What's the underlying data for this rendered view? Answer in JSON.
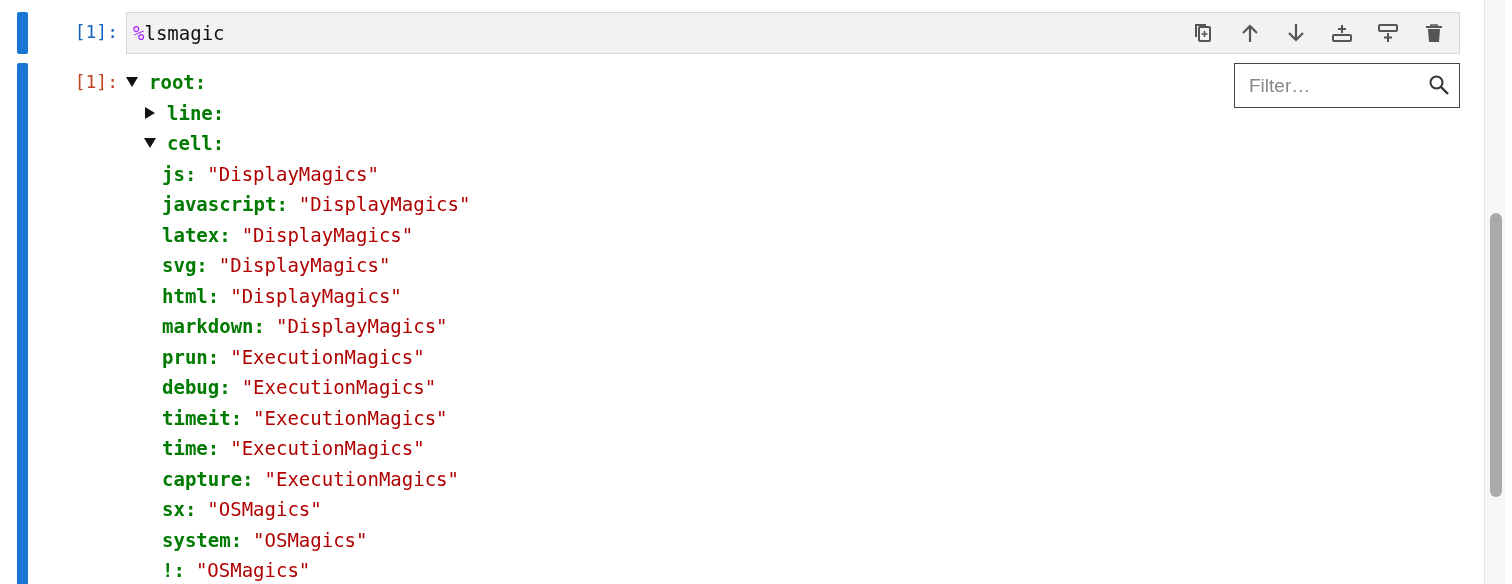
{
  "input_cell": {
    "prompt": "[1]:",
    "code": {
      "prefix": "%",
      "rest": "lsmagic"
    },
    "active": true,
    "toolbar": [
      {
        "kind": "duplicate"
      },
      {
        "kind": "move-up"
      },
      {
        "kind": "move-down"
      },
      {
        "kind": "insert-above"
      },
      {
        "kind": "insert-below"
      },
      {
        "kind": "delete"
      }
    ]
  },
  "output_cell": {
    "prompt": "[1]:",
    "active": true,
    "filter": {
      "placeholder": "Filter…"
    },
    "tree": [
      {
        "key": "root:",
        "expanded": true,
        "children": [
          {
            "key": "line:",
            "expanded": false
          },
          {
            "key": "cell:",
            "expanded": true,
            "children": [
              {
                "key": "js:",
                "value": "\"DisplayMagics\""
              },
              {
                "key": "javascript:",
                "value": "\"DisplayMagics\""
              },
              {
                "key": "latex:",
                "value": "\"DisplayMagics\""
              },
              {
                "key": "svg:",
                "value": "\"DisplayMagics\""
              },
              {
                "key": "html:",
                "value": "\"DisplayMagics\""
              },
              {
                "key": "markdown:",
                "value": "\"DisplayMagics\""
              },
              {
                "key": "prun:",
                "value": "\"ExecutionMagics\""
              },
              {
                "key": "debug:",
                "value": "\"ExecutionMagics\""
              },
              {
                "key": "timeit:",
                "value": "\"ExecutionMagics\""
              },
              {
                "key": "time:",
                "value": "\"ExecutionMagics\""
              },
              {
                "key": "capture:",
                "value": "\"ExecutionMagics\""
              },
              {
                "key": "sx:",
                "value": "\"OSMagics\""
              },
              {
                "key": "system:",
                "value": "\"OSMagics\""
              },
              {
                "key": "!:",
                "value": "\"OSMagics\""
              }
            ]
          }
        ]
      }
    ]
  }
}
